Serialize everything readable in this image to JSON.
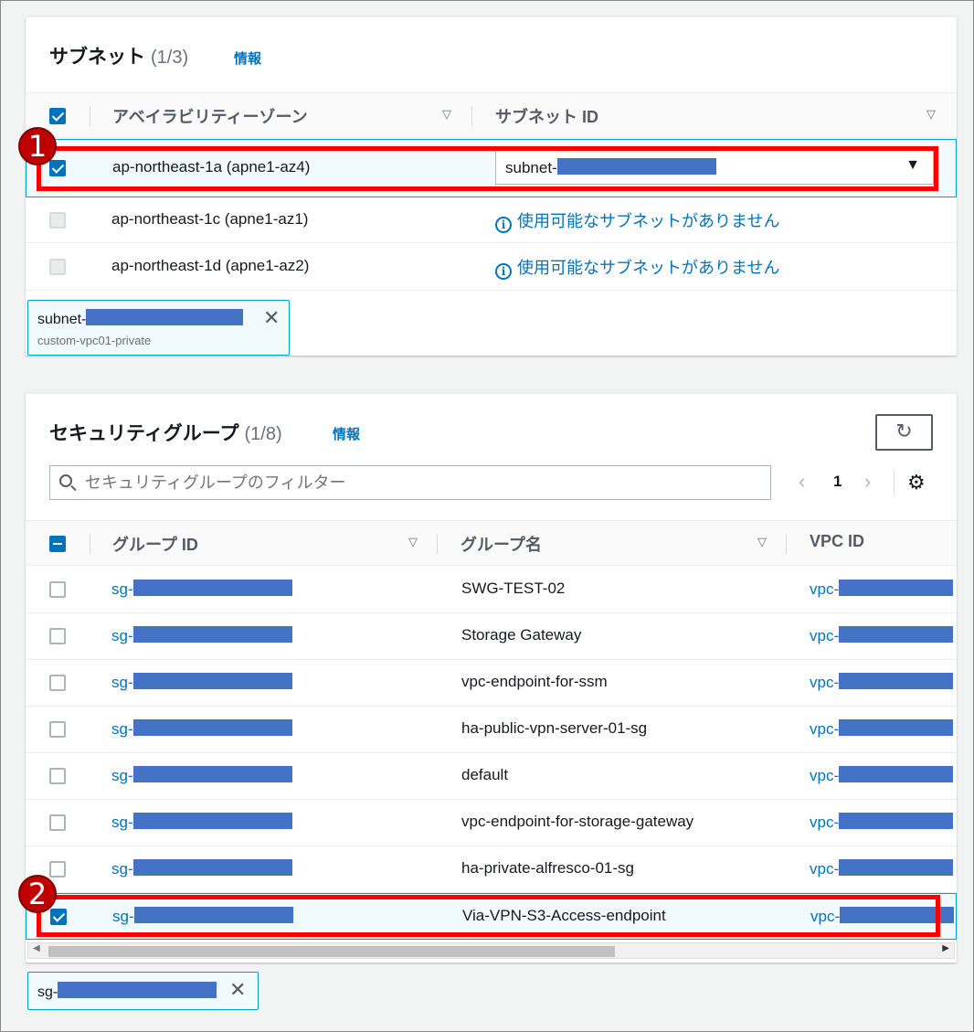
{
  "subnets": {
    "title": "サブネット",
    "count": "(1/3)",
    "info": "情報",
    "columns": [
      "アベイラビリティーゾーン",
      "サブネット ID"
    ],
    "rows": [
      {
        "az": "ap-northeast-1a (apne1-az4)",
        "subnet": "subnet-",
        "checked": true
      },
      {
        "az": "ap-northeast-1c (apne1-az1)",
        "subnet": "使用可能なサブネットがありません",
        "checked": false
      },
      {
        "az": "ap-northeast-1d (apne1-az2)",
        "subnet": "使用可能なサブネットがありません",
        "checked": false
      }
    ],
    "token": {
      "id": "subnet-",
      "name": "custom-vpc01-private"
    }
  },
  "security_groups": {
    "title": "セキュリティグループ",
    "count": "(1/8)",
    "info": "情報",
    "filter_placeholder": "セキュリティグループのフィルター",
    "page": "1",
    "columns": [
      "グループ ID",
      "グループ名",
      "VPC ID"
    ],
    "rows": [
      {
        "id": "sg-",
        "name": "SWG-TEST-02",
        "vpc": "vpc-",
        "checked": false
      },
      {
        "id": "sg-",
        "name": "Storage Gateway",
        "vpc": "vpc-",
        "checked": false
      },
      {
        "id": "sg-",
        "name": "vpc-endpoint-for-ssm",
        "vpc": "vpc-",
        "checked": false
      },
      {
        "id": "sg-",
        "name": "ha-public-vpn-server-01-sg",
        "vpc": "vpc-",
        "checked": false
      },
      {
        "id": "sg-",
        "name": "default",
        "vpc": "vpc-",
        "checked": false
      },
      {
        "id": "sg-",
        "name": "vpc-endpoint-for-storage-gateway",
        "vpc": "vpc-",
        "checked": false
      },
      {
        "id": "sg-",
        "name": "ha-private-alfresco-01-sg",
        "vpc": "vpc-",
        "checked": false
      },
      {
        "id": "sg-",
        "name": "Via-VPN-S3-Access-endpoint",
        "vpc": "vpc-",
        "checked": true
      }
    ],
    "token": {
      "id": "sg-"
    }
  },
  "annotations": {
    "badge1": "1",
    "badge2": "2"
  },
  "colors": {
    "accent": "#0073bb",
    "highlight": "#ff0000",
    "redaction": "#4472c4",
    "badge": "#c00000"
  },
  "icons": {
    "refresh": "refresh-icon",
    "settings": "gear-icon",
    "search": "search-icon",
    "info": "info-icon",
    "close": "close-icon",
    "sort": "sort-down-icon"
  }
}
